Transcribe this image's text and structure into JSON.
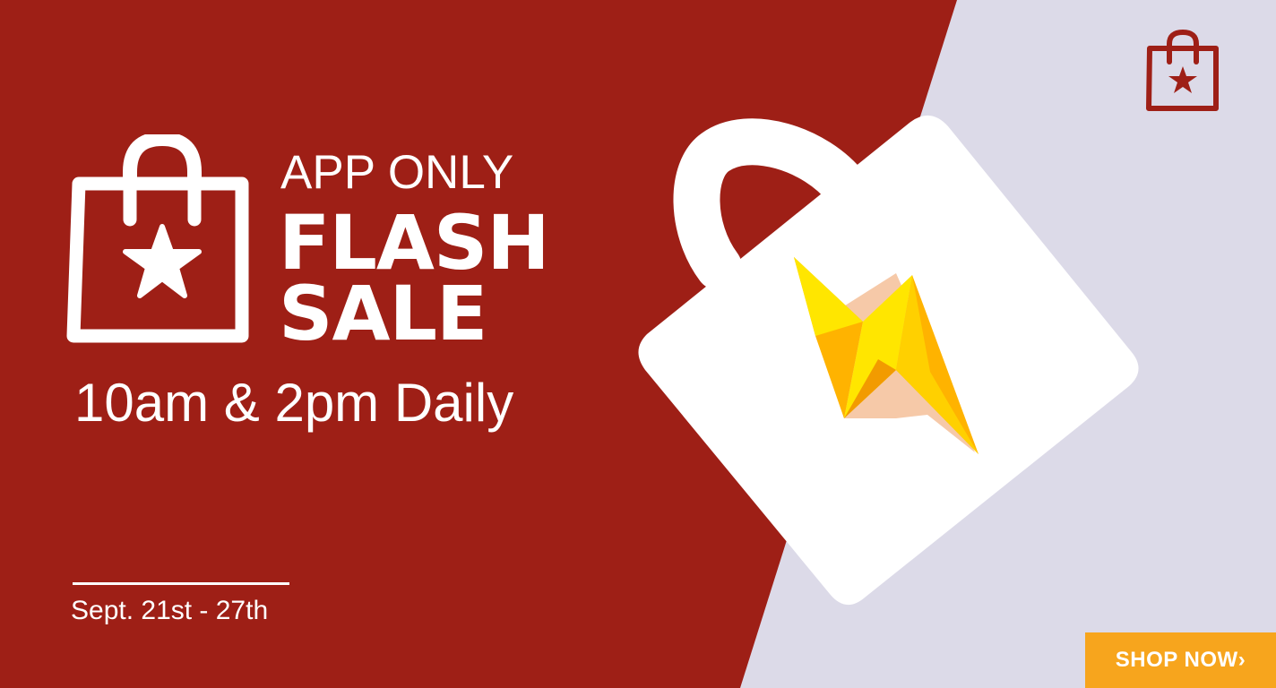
{
  "headline": {
    "line1": "APP ONLY",
    "line2": "FLASH",
    "line3": "SALE"
  },
  "schedule": "10am & 2pm Daily",
  "date_range": "Sept. 21st - 27th",
  "cta": {
    "label": "SHOP NOW›"
  },
  "icons": {
    "main": "shopping-bag-star-icon",
    "corner_logo": "shopping-bag-star-icon",
    "hero": "shopping-bag-lightning-icon"
  },
  "colors": {
    "primary_red": "#9e1f16",
    "background_lavender": "#dcdae8",
    "accent_orange": "#f7a51d",
    "lightning_yellow": "#ffe600",
    "lightning_gold": "#ffb300",
    "text_white": "#ffffff"
  }
}
